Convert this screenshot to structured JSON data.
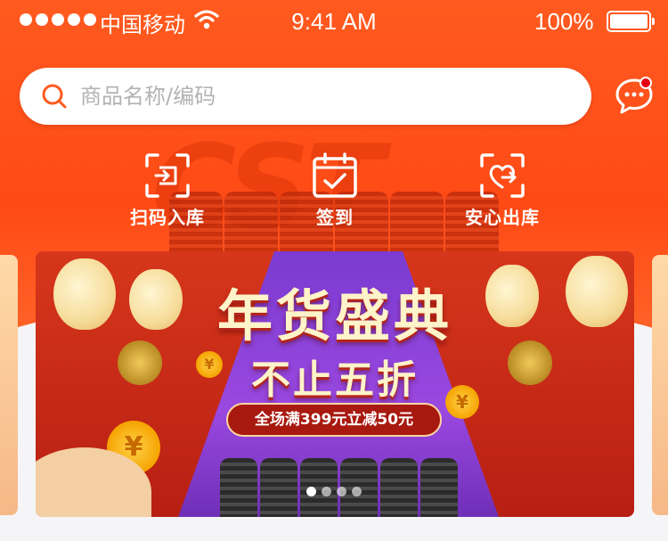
{
  "status_bar": {
    "carrier": "中国移动",
    "time": "9:41 AM",
    "battery": "100%"
  },
  "search": {
    "placeholder": "商品名称/编码"
  },
  "quick_actions": [
    {
      "label": "扫码入库",
      "icon": "scan-in-icon"
    },
    {
      "label": "签到",
      "icon": "calendar-check-icon"
    },
    {
      "label": "安心出库",
      "icon": "heart-out-icon"
    }
  ],
  "banner": {
    "title": "年货盛典",
    "subtitle": "不止五折",
    "promo": "全场满399元立减50元",
    "slide_count": 4,
    "active_slide": 1
  },
  "header_watermark": "CST",
  "colors": {
    "brand": "#ff5a1f",
    "notification": "#e60012"
  }
}
